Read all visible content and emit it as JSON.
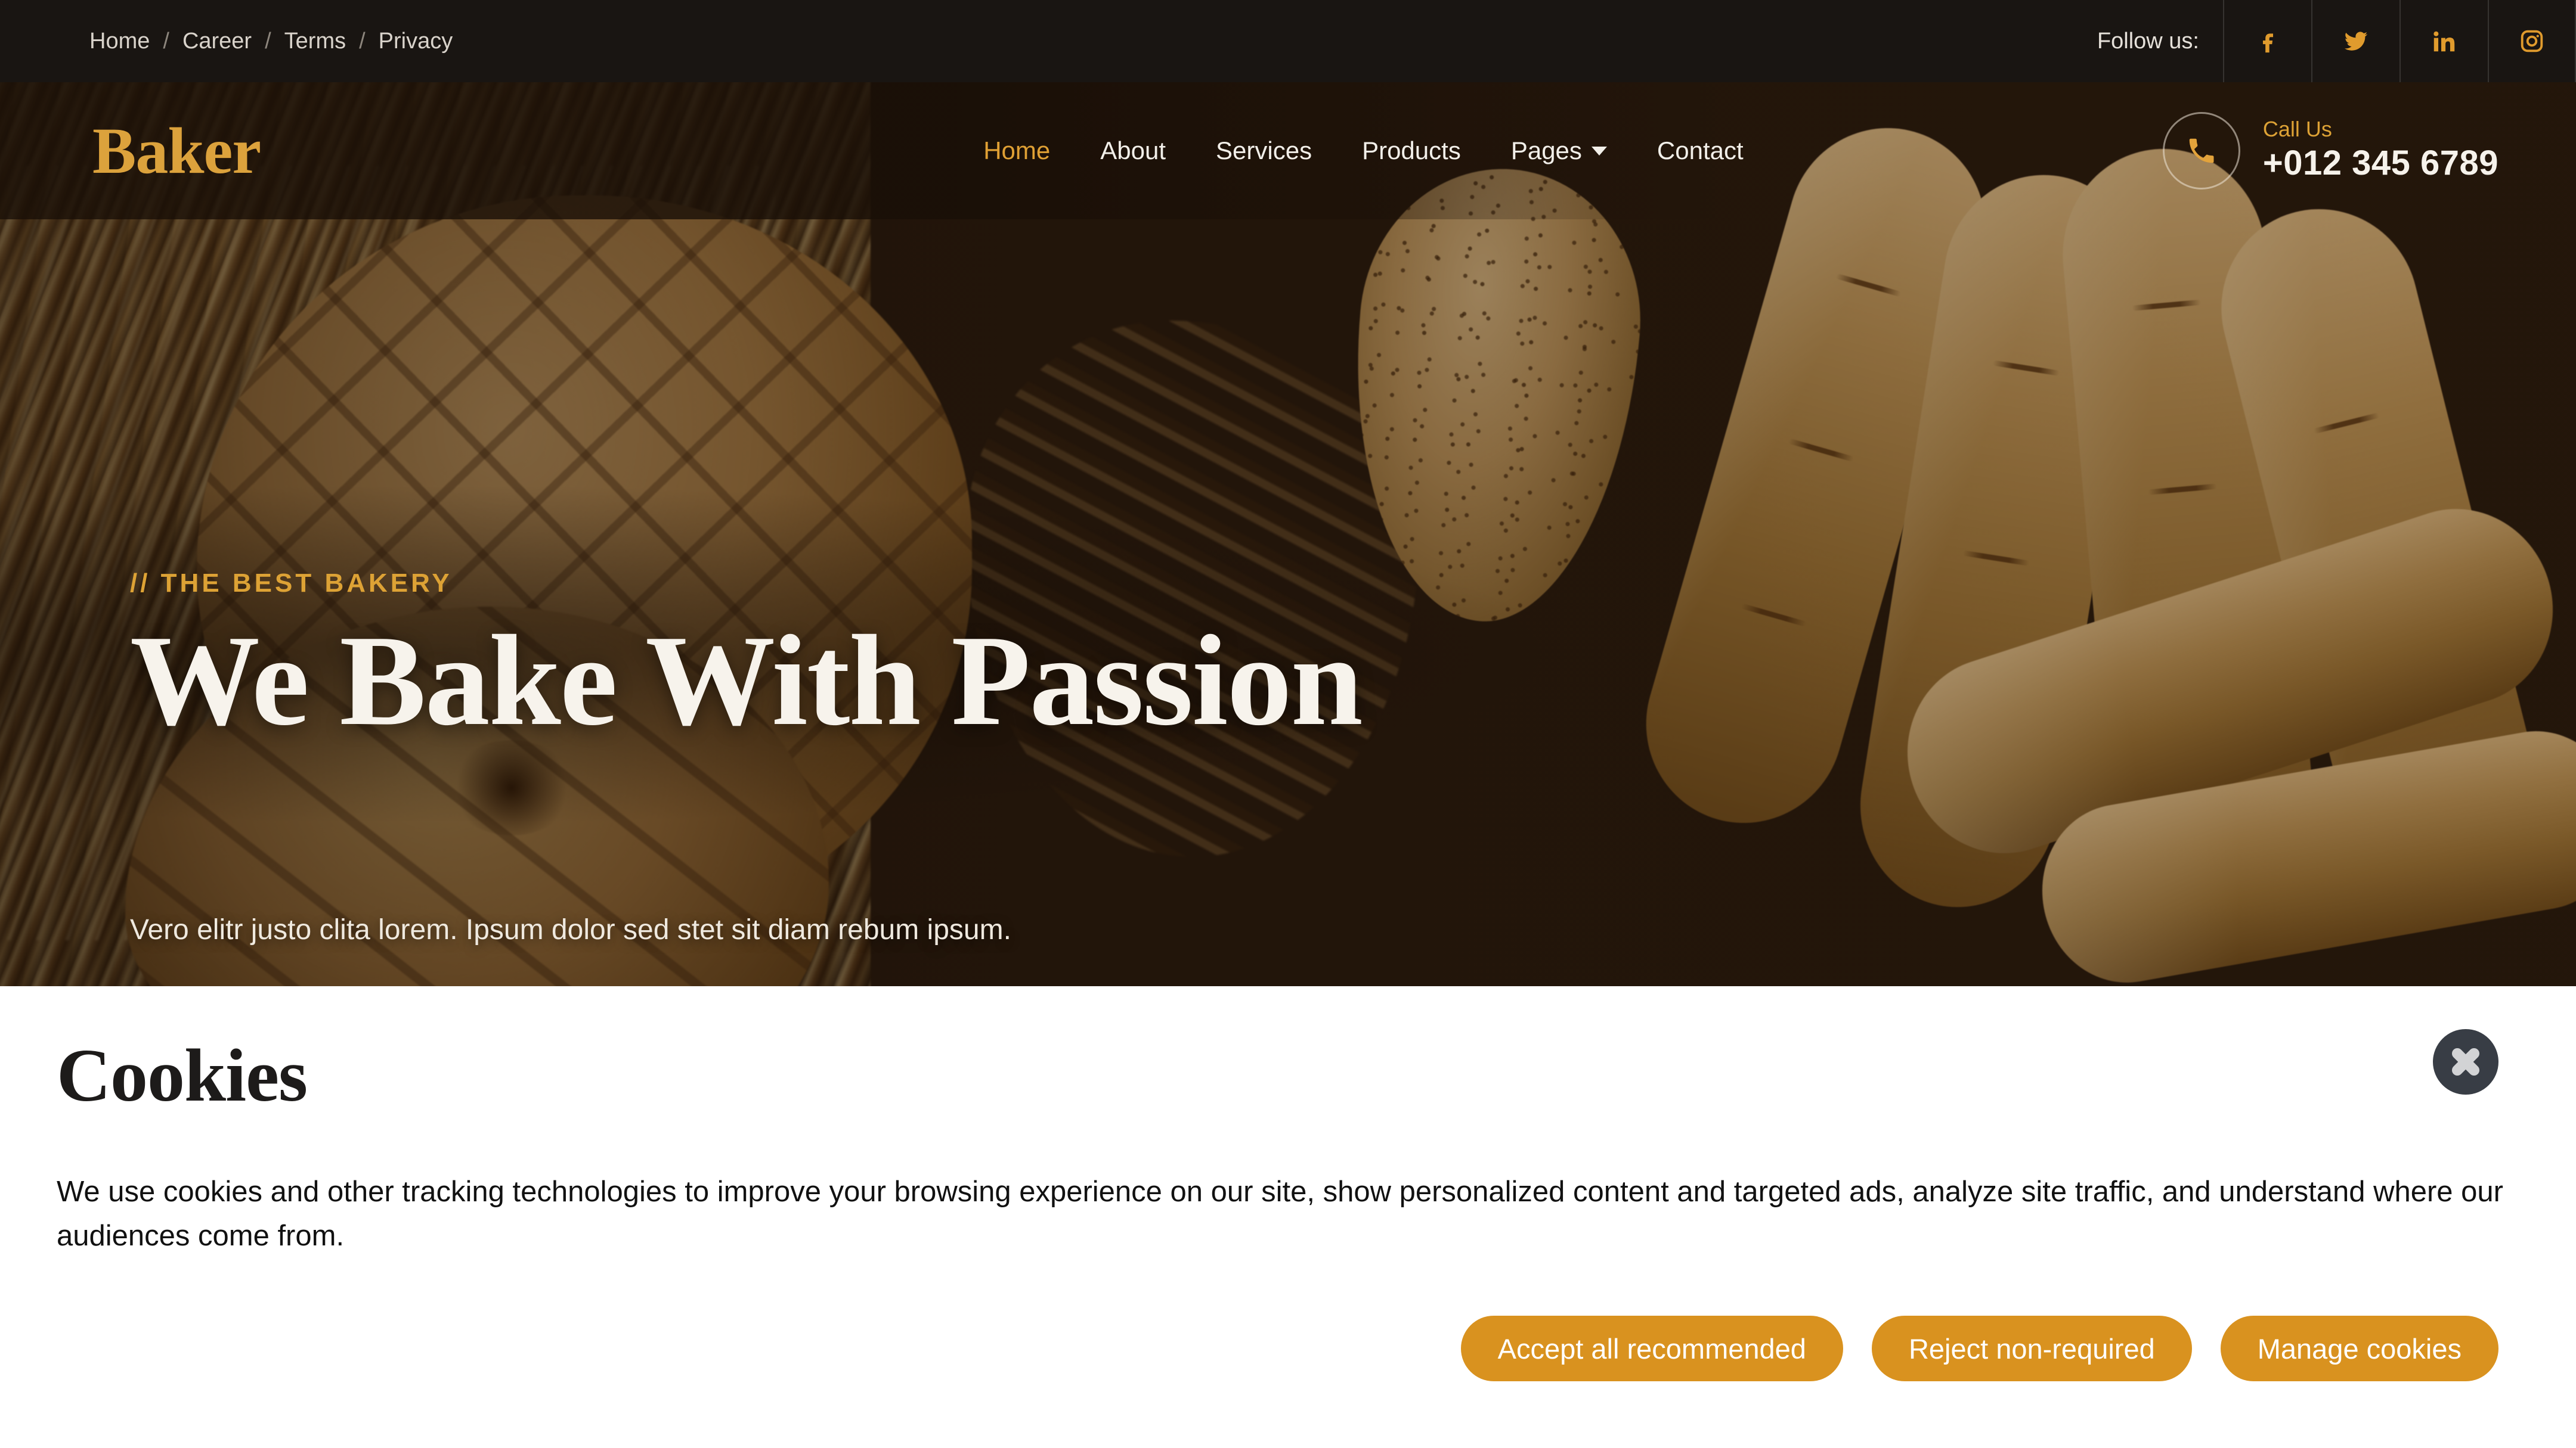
{
  "topbar": {
    "breadcrumbs": [
      {
        "label": "Home"
      },
      {
        "label": "Career"
      },
      {
        "label": "Terms"
      },
      {
        "label": "Privacy"
      }
    ],
    "separator": "/",
    "follow_label": "Follow us:",
    "social": [
      {
        "name": "facebook-icon",
        "label": "Facebook"
      },
      {
        "name": "twitter-icon",
        "label": "Twitter"
      },
      {
        "name": "linkedin-icon",
        "label": "LinkedIn"
      },
      {
        "name": "instagram-icon",
        "label": "Instagram"
      }
    ]
  },
  "navbar": {
    "logo": "Baker",
    "menu": [
      {
        "label": "Home",
        "active": true,
        "dropdown": false
      },
      {
        "label": "About",
        "active": false,
        "dropdown": false
      },
      {
        "label": "Services",
        "active": false,
        "dropdown": false
      },
      {
        "label": "Products",
        "active": false,
        "dropdown": false
      },
      {
        "label": "Pages",
        "active": false,
        "dropdown": true
      },
      {
        "label": "Contact",
        "active": false,
        "dropdown": false
      }
    ],
    "call": {
      "icon": "phone-icon",
      "label": "Call Us",
      "number": "+012 345 6789"
    }
  },
  "hero": {
    "tagline": "// THE BEST BAKERY",
    "title": "We Bake With Passion",
    "subtitle": "Vero elitr justo clita lorem. Ipsum dolor sed stet sit diam rebum ipsum."
  },
  "cookie": {
    "title": "Cookies",
    "body": "We use cookies and other tracking technologies to improve your browsing experience on our site, show personalized content and targeted ads, analyze site traffic, and understand where our audiences come from.",
    "close_icon": "close-icon",
    "buttons": [
      {
        "label": "Accept all recommended"
      },
      {
        "label": "Reject non-required"
      },
      {
        "label": "Manage cookies"
      }
    ]
  },
  "colors": {
    "accent": "#dda235",
    "button": "#d9921f",
    "topbar_bg": "#191512",
    "close_bg": "#383d45",
    "hero_title": "#f7f3ec"
  }
}
